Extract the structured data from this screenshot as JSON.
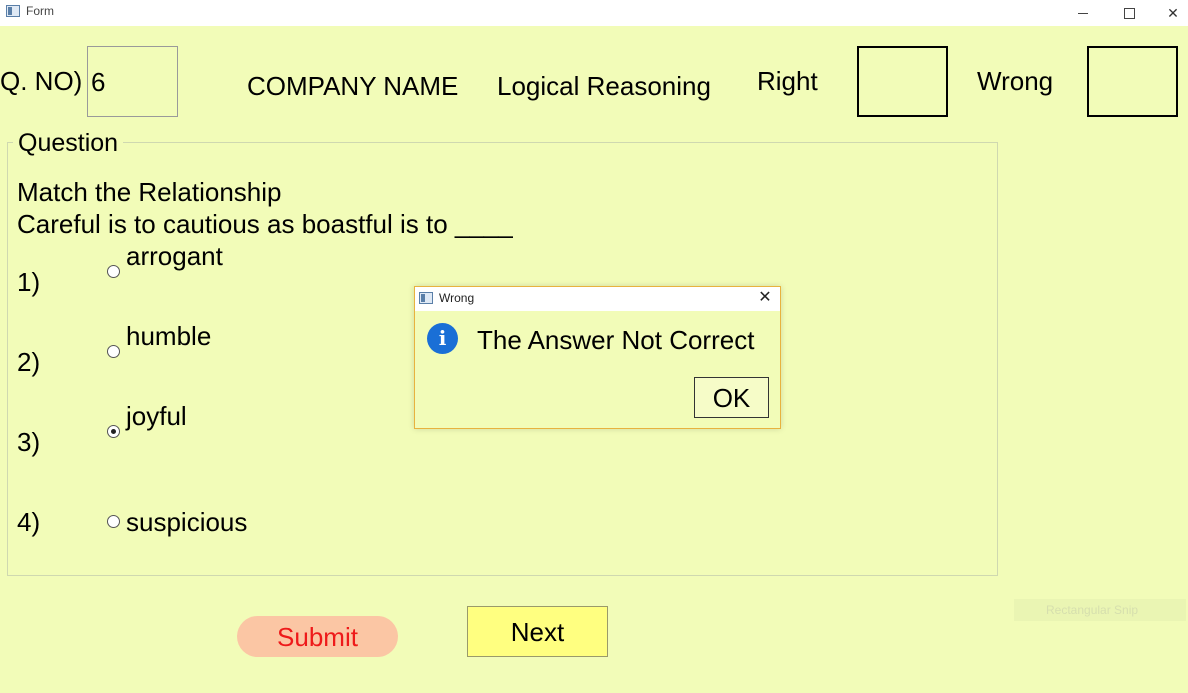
{
  "window": {
    "title": "Form",
    "minimize_glyph": "",
    "close_glyph": "✕"
  },
  "header": {
    "qno_label": "Q. NO)",
    "qno_value": "6",
    "company": "COMPANY NAME",
    "category": "Logical Reasoning",
    "right_label": "Right",
    "right_value": "",
    "wrong_label": "Wrong",
    "wrong_value": ""
  },
  "question": {
    "group_title": "Question",
    "line1": "Match the Relationship",
    "line2": "Careful is to cautious as boastful is to ____",
    "options": [
      {
        "num": "1)",
        "text": "arrogant",
        "checked": false
      },
      {
        "num": "2)",
        "text": "humble",
        "checked": false
      },
      {
        "num": "3)",
        "text": "joyful",
        "checked": true
      },
      {
        "num": "4)",
        "text": "suspicious",
        "checked": false
      }
    ]
  },
  "buttons": {
    "submit": "Submit",
    "next": "Next"
  },
  "background_snip": "Rectangular Snip",
  "dialog": {
    "title": "Wrong",
    "message": "The Answer Not Correct",
    "ok": "OK",
    "close_glyph": "✕",
    "info_glyph": "i"
  },
  "colors": {
    "background": "#f2fcb8",
    "submit_bg": "#fbc6a4",
    "submit_text": "#ee1a1a",
    "next_bg": "#ffff80",
    "info_icon": "#1a6fd6"
  }
}
